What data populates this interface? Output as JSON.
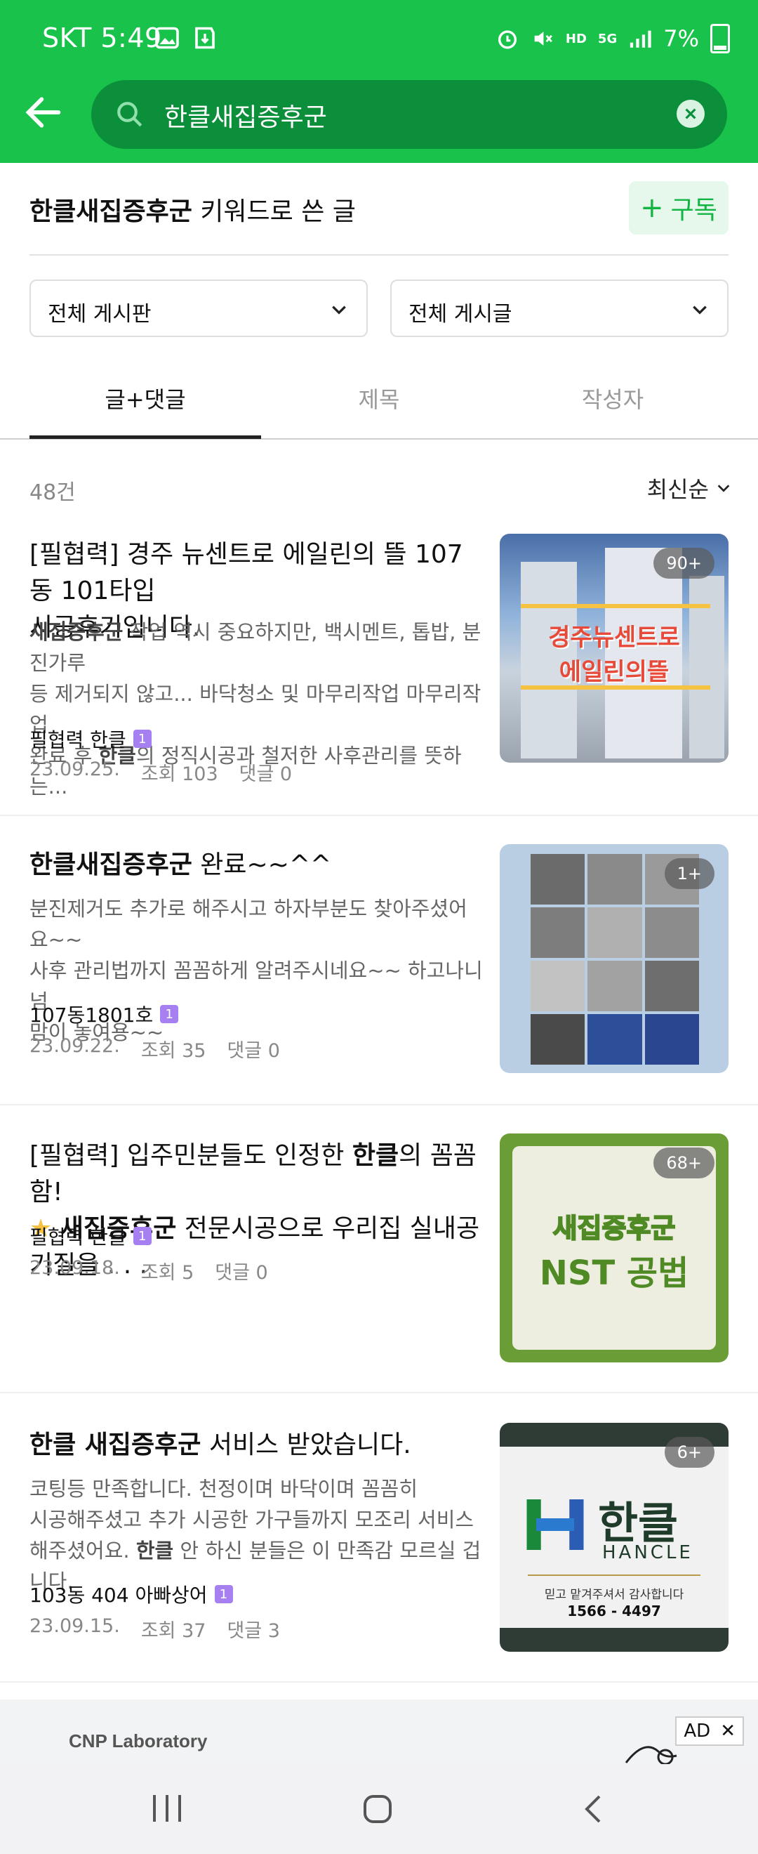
{
  "status": {
    "carrier_time": "SKT 5:49",
    "battery": "7%",
    "net1": "HD",
    "net2": "5G"
  },
  "search": {
    "query": "한클새집증후군"
  },
  "keyword": {
    "term": "한클새집증후군",
    "suffix": " 키워드로 쓴 글",
    "subscribe_label": "구독"
  },
  "filters": [
    {
      "label": "전체 게시판"
    },
    {
      "label": "전체 게시글"
    }
  ],
  "tabs": [
    {
      "label": "글+댓글",
      "active": true
    },
    {
      "label": "제목",
      "active": false
    },
    {
      "label": "작성자",
      "active": false
    }
  ],
  "results": {
    "count": "48건",
    "sort": "최신순"
  },
  "items": [
    {
      "title_line1": "[필협력] 경주 뉴센트로 에일린의 뜰 107동 101타입",
      "title_line2": "시공후기입니다.",
      "snippet_bold1": "새집증후군",
      "snippet_line1_rest": " 작업 역시 중요하지만, 백시멘트, 톱밥, 분진가루",
      "snippet_line2": "등 제거되지 않고... 바닥청소 및 마무리작업 마무리작업",
      "snippet_line3_a": "완료 후 ",
      "snippet_bold2": "한클",
      "snippet_line3_b": "의 정직시공과 철저한 사후관리를 뜻하는...",
      "author": "필협력 한클",
      "date": "23.09.25.",
      "views": "조회 103",
      "comments": "댓글 0",
      "thumb_count": "90+",
      "thumb_text1": "경주뉴센트로",
      "thumb_text2": "에일린의뜰"
    },
    {
      "title_bold": "한클새집증후군",
      "title_rest": " 완료~~^^",
      "snippet_line1": "분진제거도 추가로 해주시고 하자부분도 찾아주셨어요~~",
      "snippet_line2": "사후 관리법까지 꼼꼼하게 알려주시네요~~ 하고나니 넘",
      "snippet_line3": "맘이 놓여용~~",
      "author": "107동1801호",
      "date": "23.09.22.",
      "views": "조회 35",
      "comments": "댓글 0",
      "thumb_count": "1+"
    },
    {
      "title_line1_a": "[필협력] 입주민분들도 인정한 ",
      "title_bold1": "한클",
      "title_line1_b": "의 꼼꼼함!",
      "title_line2_bold": "새집증후군",
      "title_line2_rest": " 전문시공으로 우리집 실내공기질을 . . .",
      "author": "필협력 한클",
      "date": "23.09.18.",
      "views": "조회 5",
      "comments": "댓글 0",
      "thumb_count": "68+",
      "thumb_text1": "새집증후군",
      "thumb_text2": "NST 공법"
    },
    {
      "title_bold": "한클 새집증후군",
      "title_rest": " 서비스 받았습니다.",
      "snippet_line1": "코팅등 만족합니다. 천정이며 바닥이며 꼼꼼히",
      "snippet_line2": "시공해주셨고 추가 시공한 가구들까지 모조리 서비스",
      "snippet_line3_a": "해주셨어요. ",
      "snippet_bold": "한클",
      "snippet_line3_b": " 안 하신 분들은 이 만족감 모르실 겁니다.",
      "author": "103동 404 아빠상어",
      "date": "23.09.15.",
      "views": "조회 37",
      "comments": "댓글 3",
      "thumb_count": "6+",
      "thumb_logo": "한클",
      "thumb_logo_en": "HANCLE",
      "thumb_slogan": "믿고 맡겨주셔서 감사합니다",
      "thumb_phone": "1566 - 4497"
    }
  ],
  "ad": {
    "brand": "CNP Laboratory",
    "tag": "AD"
  },
  "colors": {
    "brand_green": "#19c24b",
    "search_bg": "#0c8f3a",
    "badge_purple": "#a680f0"
  }
}
